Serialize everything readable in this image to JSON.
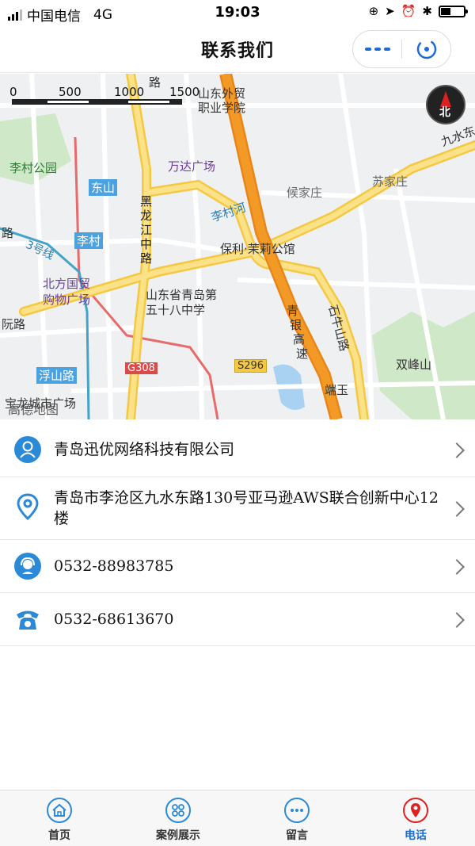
{
  "status_bar": {
    "carrier": "中国电信",
    "network": "4G",
    "time": "19:03"
  },
  "nav": {
    "title": "联系我们"
  },
  "map": {
    "scale_labels": [
      "0",
      "500",
      "1000",
      "1500"
    ],
    "compass_label": "北",
    "watermark": "高德地图",
    "places": {
      "licun_park": "李村公园",
      "dongshan": "东山",
      "licun": "李村",
      "line3": "3号线",
      "beifang_1": "北方国贸",
      "beifang_2": "购物广场",
      "wanda": "万达广场",
      "heilongjiang_1": "黑",
      "heilongjiang_2": "龙",
      "heilongjiang_3": "江",
      "heilongjiang_4": "中",
      "heilongjiang_5": "路",
      "licun_river": "李村河",
      "poly": "保利·茉莉公馆",
      "school_1": "山东省青岛第",
      "school_2": "五十八中学",
      "foreign_1": "山东外贸",
      "foreign_2": "职业学院",
      "houjiazhuang": "候家庄",
      "sujiazhuang": "苏家庄",
      "jiushui": "九水东",
      "shiniushan": "石牛山路",
      "shuangfeng": "双峰山",
      "qingyin_1": "青",
      "qingyin_2": "银",
      "qingyin_3": "高",
      "qingyin_4": "速",
      "g308": "G308",
      "s296": "S296",
      "fushan": "浮山路",
      "baolong": "宝龙城市广场",
      "duanyu": "端玉",
      "road_left": "路",
      "road_left2": "阮路",
      "road_top": "路"
    }
  },
  "contacts": [
    {
      "icon": "user-icon",
      "text": "青岛迅优网络科技有限公司"
    },
    {
      "icon": "location-pin-icon",
      "text": "青岛市李沧区九水东路130号亚马逊AWS联合创新中心12楼"
    },
    {
      "icon": "customer-service-icon",
      "text": "0532-88983785"
    },
    {
      "icon": "telephone-icon",
      "text": "0532-68613670"
    }
  ],
  "tabs": [
    {
      "label": "首页",
      "icon": "home-icon",
      "active": false
    },
    {
      "label": "案例展示",
      "icon": "grid-icon",
      "active": false
    },
    {
      "label": "留言",
      "icon": "chat-icon",
      "active": false
    },
    {
      "label": "电话",
      "icon": "location-pin-icon",
      "active": true
    }
  ],
  "colors": {
    "accent_blue": "#1a6fd4",
    "active_red": "#e02020",
    "highway_orange": "#f39a26",
    "road_yellow": "#f7d85e"
  }
}
